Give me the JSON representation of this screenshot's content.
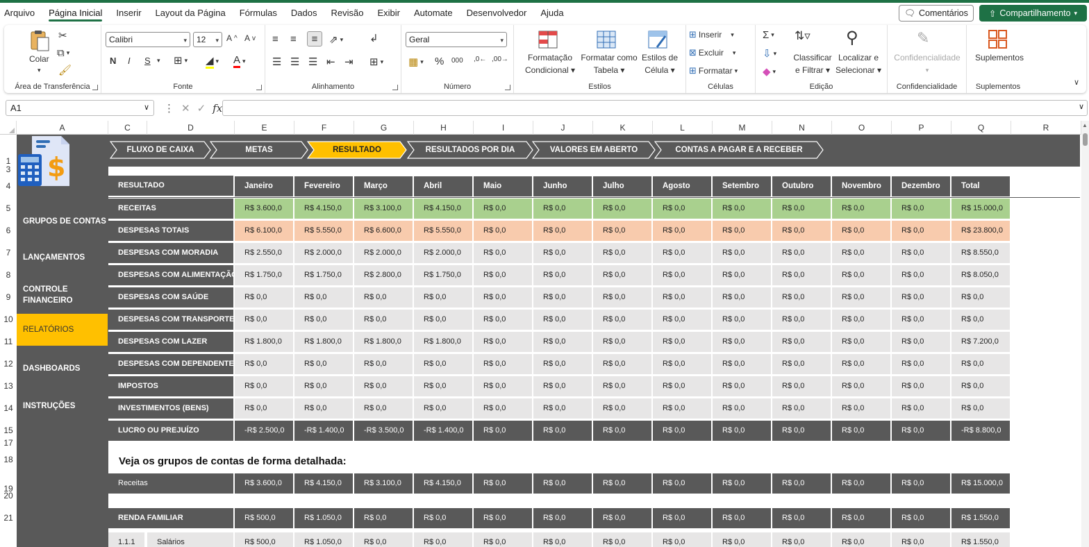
{
  "menu": {
    "items": [
      "Arquivo",
      "Página Inicial",
      "Inserir",
      "Layout da Página",
      "Fórmulas",
      "Dados",
      "Revisão",
      "Exibir",
      "Automate",
      "Desenvolvedor",
      "Ajuda"
    ],
    "active_index": 1,
    "comments_label": "Comentários",
    "share_label": "Compartilhamento"
  },
  "ribbon": {
    "clipboard": {
      "paste": "Colar",
      "label": "Área de Transferência"
    },
    "font": {
      "name": "Calibri",
      "size": "12",
      "bold": "N",
      "italic": "I",
      "underline": "S",
      "label": "Fonte"
    },
    "alignment": {
      "label": "Alinhamento"
    },
    "number": {
      "format": "Geral",
      "label": "Número"
    },
    "styles": {
      "conditional": "Formatação",
      "conditional2": "Condicional",
      "table": "Formatar como",
      "table2": "Tabela",
      "cell": "Estilos de",
      "cell2": "Célula",
      "label": "Estilos"
    },
    "cells": {
      "insert": "Inserir",
      "delete": "Excluir",
      "format": "Formatar",
      "label": "Células"
    },
    "editing": {
      "sort": "Classificar",
      "sort2": "e Filtrar",
      "find": "Localizar e",
      "find2": "Selecionar",
      "label": "Edição"
    },
    "sensitivity": {
      "btn": "Confidencialidade",
      "label": "Confidencialidade"
    },
    "addins": {
      "btn": "Suplementos",
      "label": "Suplementos"
    }
  },
  "formula_bar": {
    "name_box": "A1",
    "fx": "fx",
    "value": ""
  },
  "columns": [
    "A",
    "C",
    "D",
    "E",
    "F",
    "G",
    "H",
    "I",
    "J",
    "K",
    "L",
    "M",
    "N",
    "O",
    "P",
    "Q",
    "R"
  ],
  "rows": [
    "1",
    "3",
    "4",
    "5",
    "6",
    "7",
    "8",
    "9",
    "10",
    "11",
    "12",
    "13",
    "14",
    "15",
    "17",
    "18",
    "19",
    "20",
    "21"
  ],
  "sidebar": {
    "items": [
      "GRUPOS DE CONTAS",
      "LANÇAMENTOS",
      "CONTROLE FINANCEIRO",
      "RELATÓRIOS",
      "DASHBOARDS",
      "INSTRUÇÕES"
    ],
    "active_index": 3
  },
  "nav_tabs": [
    "FLUXO DE CAIXA",
    "METAS",
    "RESULTADO",
    "RESULTADOS POR DIA",
    "VALORES EM ABERTO",
    "CONTAS A PAGAR E A  RECEBER"
  ],
  "active_tab": 2,
  "table": {
    "corner": "RESULTADO",
    "months": [
      "Janeiro",
      "Fevereiro",
      "Março",
      "Abril",
      "Maio",
      "Junho",
      "Julho",
      "Agosto",
      "Setembro",
      "Outubro",
      "Novembro",
      "Dezembro",
      "Total"
    ],
    "rows": [
      {
        "label": "RECEITAS",
        "style": "green",
        "values": [
          "R$ 3.600,0",
          "R$ 4.150,0",
          "R$ 3.100,0",
          "R$ 4.150,0",
          "R$ 0,0",
          "R$ 0,0",
          "R$ 0,0",
          "R$ 0,0",
          "R$ 0,0",
          "R$ 0,0",
          "R$ 0,0",
          "R$ 0,0",
          "R$ 15.000,0"
        ]
      },
      {
        "label": "DESPESAS TOTAIS",
        "style": "peach",
        "values": [
          "R$ 6.100,0",
          "R$ 5.550,0",
          "R$ 6.600,0",
          "R$ 5.550,0",
          "R$ 0,0",
          "R$ 0,0",
          "R$ 0,0",
          "R$ 0,0",
          "R$ 0,0",
          "R$ 0,0",
          "R$ 0,0",
          "R$ 0,0",
          "R$ 23.800,0"
        ]
      },
      {
        "label": "DESPESAS COM MORADIA",
        "style": "gray",
        "values": [
          "R$ 2.550,0",
          "R$ 2.000,0",
          "R$ 2.000,0",
          "R$ 2.000,0",
          "R$ 0,0",
          "R$ 0,0",
          "R$ 0,0",
          "R$ 0,0",
          "R$ 0,0",
          "R$ 0,0",
          "R$ 0,0",
          "R$ 0,0",
          "R$ 8.550,0"
        ]
      },
      {
        "label": "DESPESAS COM ALIMENTAÇÃO",
        "style": "gray",
        "values": [
          "R$ 1.750,0",
          "R$ 1.750,0",
          "R$ 2.800,0",
          "R$ 1.750,0",
          "R$ 0,0",
          "R$ 0,0",
          "R$ 0,0",
          "R$ 0,0",
          "R$ 0,0",
          "R$ 0,0",
          "R$ 0,0",
          "R$ 0,0",
          "R$ 8.050,0"
        ]
      },
      {
        "label": "DESPESAS COM SAÚDE",
        "style": "gray",
        "values": [
          "R$ 0,0",
          "R$ 0,0",
          "R$ 0,0",
          "R$ 0,0",
          "R$ 0,0",
          "R$ 0,0",
          "R$ 0,0",
          "R$ 0,0",
          "R$ 0,0",
          "R$ 0,0",
          "R$ 0,0",
          "R$ 0,0",
          "R$ 0,0"
        ]
      },
      {
        "label": "DESPESAS COM TRANSPORTES",
        "style": "gray",
        "values": [
          "R$ 0,0",
          "R$ 0,0",
          "R$ 0,0",
          "R$ 0,0",
          "R$ 0,0",
          "R$ 0,0",
          "R$ 0,0",
          "R$ 0,0",
          "R$ 0,0",
          "R$ 0,0",
          "R$ 0,0",
          "R$ 0,0",
          "R$ 0,0"
        ]
      },
      {
        "label": "DESPESAS COM LAZER",
        "style": "gray",
        "values": [
          "R$ 1.800,0",
          "R$ 1.800,0",
          "R$ 1.800,0",
          "R$ 1.800,0",
          "R$ 0,0",
          "R$ 0,0",
          "R$ 0,0",
          "R$ 0,0",
          "R$ 0,0",
          "R$ 0,0",
          "R$ 0,0",
          "R$ 0,0",
          "R$ 7.200,0"
        ]
      },
      {
        "label": "DESPESAS COM DEPENDENTES",
        "style": "gray",
        "values": [
          "R$ 0,0",
          "R$ 0,0",
          "R$ 0,0",
          "R$ 0,0",
          "R$ 0,0",
          "R$ 0,0",
          "R$ 0,0",
          "R$ 0,0",
          "R$ 0,0",
          "R$ 0,0",
          "R$ 0,0",
          "R$ 0,0",
          "R$ 0,0"
        ]
      },
      {
        "label": "IMPOSTOS",
        "style": "gray",
        "values": [
          "R$ 0,0",
          "R$ 0,0",
          "R$ 0,0",
          "R$ 0,0",
          "R$ 0,0",
          "R$ 0,0",
          "R$ 0,0",
          "R$ 0,0",
          "R$ 0,0",
          "R$ 0,0",
          "R$ 0,0",
          "R$ 0,0",
          "R$ 0,0"
        ]
      },
      {
        "label": "INVESTIMENTOS (BENS)",
        "style": "gray",
        "values": [
          "R$ 0,0",
          "R$ 0,0",
          "R$ 0,0",
          "R$ 0,0",
          "R$ 0,0",
          "R$ 0,0",
          "R$ 0,0",
          "R$ 0,0",
          "R$ 0,0",
          "R$ 0,0",
          "R$ 0,0",
          "R$ 0,0",
          "R$ 0,0"
        ]
      },
      {
        "label": "LUCRO OU PREJUÍZO",
        "style": "dark",
        "values": [
          "-R$ 2.500,0",
          "-R$ 1.400,0",
          "-R$ 3.500,0",
          "-R$ 1.400,0",
          "R$ 0,0",
          "R$ 0,0",
          "R$ 0,0",
          "R$ 0,0",
          "R$ 0,0",
          "R$ 0,0",
          "R$ 0,0",
          "R$ 0,0",
          "-R$ 8.800,0"
        ]
      }
    ]
  },
  "detail": {
    "title": "Veja os grupos de contas de forma detalhada:",
    "receitas": {
      "label": "Receitas",
      "values": [
        "R$ 3.600,0",
        "R$ 4.150,0",
        "R$ 3.100,0",
        "R$ 4.150,0",
        "R$ 0,0",
        "R$ 0,0",
        "R$ 0,0",
        "R$ 0,0",
        "R$ 0,0",
        "R$ 0,0",
        "R$ 0,0",
        "R$ 0,0",
        "R$ 15.000,0"
      ]
    },
    "renda": {
      "label": "RENDA FAMILIAR",
      "values": [
        "R$ 500,0",
        "R$ 1.050,0",
        "R$ 0,0",
        "R$ 0,0",
        "R$ 0,0",
        "R$ 0,0",
        "R$ 0,0",
        "R$ 0,0",
        "R$ 0,0",
        "R$ 0,0",
        "R$ 0,0",
        "R$ 0,0",
        "R$ 1.550,0"
      ]
    },
    "salarios": {
      "code": "1.1.1",
      "label": "Salários",
      "values": [
        "R$ 500,0",
        "R$ 1.050,0",
        "R$ 0,0",
        "R$ 0,0",
        "R$ 0,0",
        "R$ 0,0",
        "R$ 0,0",
        "R$ 0,0",
        "R$ 0,0",
        "R$ 0,0",
        "R$ 0,0",
        "R$ 0,0",
        "R$ 1.550,0"
      ]
    }
  },
  "colors": {
    "accent": "#1e7145",
    "band": "#595959",
    "active_tab": "#ffc000",
    "receitas": "#a9d08e",
    "despesas": "#f8cbad",
    "neutral": "#e7e6e6"
  }
}
